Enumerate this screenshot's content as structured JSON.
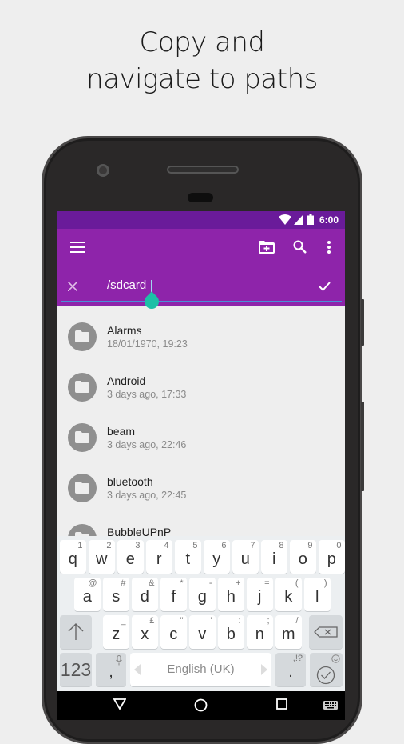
{
  "headline": {
    "line1": "Copy and",
    "line2": "navigate to paths"
  },
  "status_bar": {
    "time": "6:00",
    "icons": [
      "wifi-icon",
      "signal-icon",
      "battery-icon"
    ]
  },
  "app_bar": {
    "menu_icon": "menu-icon",
    "actions": [
      "new-folder-icon",
      "search-icon",
      "more-vert-icon"
    ]
  },
  "path_editor": {
    "value": "/sdcard",
    "cancel_icon": "close-icon",
    "confirm_icon": "check-icon"
  },
  "colors": {
    "primary": "#8e24aa",
    "primary_dark": "#6a1b9a",
    "accent": "#1dbfa7"
  },
  "files": [
    {
      "name": "Alarms",
      "modified": "18/01/1970, 19:23"
    },
    {
      "name": "Android",
      "modified": "3 days ago, 17:33"
    },
    {
      "name": "beam",
      "modified": "3 days ago, 22:46"
    },
    {
      "name": "bluetooth",
      "modified": "3 days ago, 22:45"
    },
    {
      "name": "BubbleUPnP",
      "modified": ""
    }
  ],
  "keyboard": {
    "row1": [
      [
        "q",
        "1"
      ],
      [
        "w",
        "2"
      ],
      [
        "e",
        "3"
      ],
      [
        "r",
        "4"
      ],
      [
        "t",
        "5"
      ],
      [
        "y",
        "6"
      ],
      [
        "u",
        "7"
      ],
      [
        "i",
        "8"
      ],
      [
        "o",
        "9"
      ],
      [
        "p",
        "0"
      ]
    ],
    "row2": [
      [
        "a",
        "@"
      ],
      [
        "s",
        "#"
      ],
      [
        "d",
        "&"
      ],
      [
        "f",
        "*"
      ],
      [
        "g",
        "-"
      ],
      [
        "h",
        "+"
      ],
      [
        "j",
        "="
      ],
      [
        "k",
        "("
      ],
      [
        "l",
        ")"
      ]
    ],
    "row3": [
      [
        "z",
        "_"
      ],
      [
        "x",
        "£"
      ],
      [
        "c",
        "\""
      ],
      [
        "v",
        "'"
      ],
      [
        "b",
        ":"
      ],
      [
        "n",
        ";"
      ],
      [
        "m",
        "/"
      ]
    ],
    "numbers_key": "123",
    "comma_key": ",",
    "space_label": "English (UK)",
    "period_key": ".",
    "period_alt": ",!?"
  },
  "nav_bar": {
    "buttons": [
      "back-icon",
      "home-icon",
      "recents-icon",
      "keyboard-icon"
    ]
  }
}
